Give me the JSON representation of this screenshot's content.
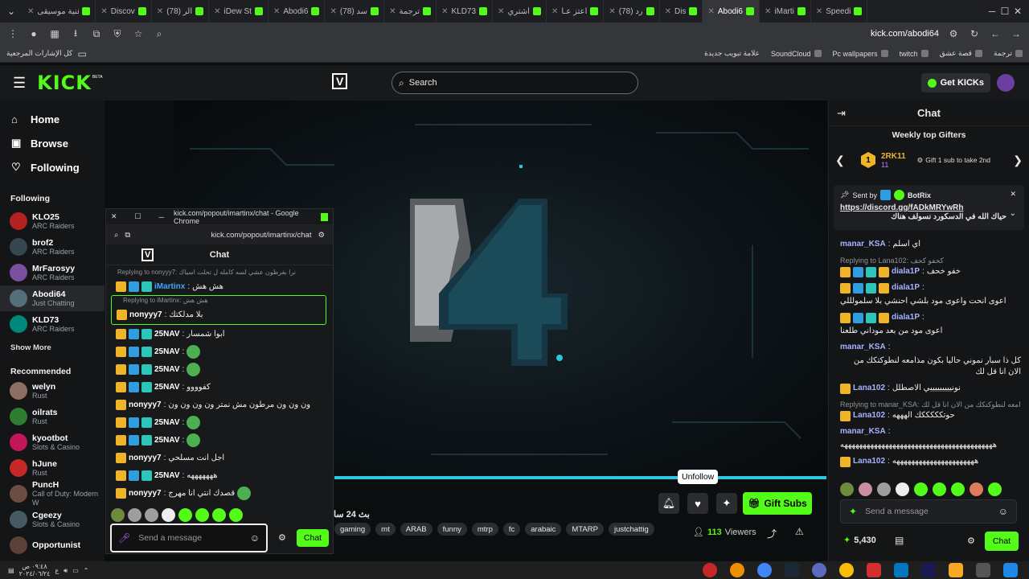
{
  "browser": {
    "tabs": [
      "اغنية موسيقى",
      "Discov",
      "(78) الر",
      "iDew St",
      "Abodi6",
      "(78) سد",
      "ترجمة",
      "KLD73",
      "اشتري",
      "اعتز عـا",
      "(78) رد",
      "Dis",
      "Abodi6",
      "iMarti",
      "Speedi"
    ],
    "url": "kick.com/abodi64",
    "bookmarks_left": "كل الإشارات المرجعية",
    "bookmarks": [
      "SoundCloud",
      "Pc wallpapers",
      "twitch",
      "قصة عشق",
      "ترجمة"
    ],
    "new_tab_bookmark": "علامة تبويب جديدة"
  },
  "header": {
    "logo": "KICK",
    "logo_beta": "BETA",
    "search_placeholder": "Search",
    "get_kicks": "Get KICKs"
  },
  "sidebar": {
    "nav": [
      {
        "label": "Home",
        "icon": "home-icon"
      },
      {
        "label": "Browse",
        "icon": "browse-icon"
      },
      {
        "label": "Following",
        "icon": "heart-icon"
      }
    ],
    "following_title": "Following",
    "following": [
      {
        "name": "KLO25",
        "sub": "ARC Raiders",
        "color": "#b22222"
      },
      {
        "name": "brof2",
        "sub": "ARC Raiders",
        "color": "#37474f"
      },
      {
        "name": "MrFarosyy",
        "sub": "ARC Raiders",
        "color": "#7b4fa0"
      },
      {
        "name": "Abodi64",
        "sub": "Just Chatting",
        "color": "#546e7a"
      },
      {
        "name": "KLD73",
        "sub": "ARC Raiders",
        "color": "#00897b"
      }
    ],
    "show_more": "Show More",
    "recommended_title": "Recommended",
    "recommended": [
      {
        "name": "welyn",
        "sub": "Rust",
        "color": "#8d6e63"
      },
      {
        "name": "oilrats",
        "sub": "Rust",
        "color": "#2e7d32"
      },
      {
        "name": "kyootbot",
        "sub": "Slots & Casino",
        "color": "#c2185b"
      },
      {
        "name": "hJune",
        "sub": "Rust",
        "color": "#c62828"
      },
      {
        "name": "PuncH",
        "sub": "Call of Duty: Modern W",
        "color": "#6d4c41"
      },
      {
        "name": "Cgeezy",
        "sub": "Slots & Casino",
        "color": "#455a64"
      },
      {
        "name": "Opportunist",
        "sub": "",
        "color": "#5d4037"
      }
    ]
  },
  "popup": {
    "title": "kick.com/popout/imartinx/chat - Google Chrome",
    "url": "kick.com/popout/imartinx/chat",
    "chat_title": "Chat",
    "messages": [
      {
        "reply": "Replying to nonyyy7: نرا بفرطون عشي لسه كامله ل تحلت اسياك",
        "user": "iMartinx",
        "color": "#3ea6ff",
        "text": "هش هش",
        "badges": 3
      },
      {
        "reply": "Replying to iMartinx: هش هش",
        "user": "nonyyy7",
        "color": "#ffffff",
        "text": "بلا مدلكتك",
        "badges": 1,
        "highlight": true
      },
      {
        "user": "25NAV",
        "color": "#ffffff",
        "text": "ابوا شمسار",
        "badges": 3
      },
      {
        "user": "25NAV",
        "color": "#ffffff",
        "text": "",
        "emote": true,
        "badges": 3
      },
      {
        "user": "25NAV",
        "color": "#ffffff",
        "text": "",
        "emote": true,
        "badges": 3
      },
      {
        "user": "25NAV",
        "color": "#ffffff",
        "text": "كفوووو",
        "badges": 3
      },
      {
        "user": "nonyyy7",
        "color": "#ffffff",
        "text": "ون ون ون مرطون مش نمتر ون ون ون ون",
        "badges": 1
      },
      {
        "user": "25NAV",
        "color": "#ffffff",
        "text": "",
        "emote": true,
        "badges": 3
      },
      {
        "user": "25NAV",
        "color": "#ffffff",
        "text": "",
        "emote": true,
        "badges": 3
      },
      {
        "user": "nonyyy7",
        "color": "#ffffff",
        "text": "اجل انت مسلحي",
        "badges": 1
      },
      {
        "user": "25NAV",
        "color": "#ffffff",
        "text": "هههههههه",
        "badges": 3
      },
      {
        "user": "nonyyy7",
        "color": "#ffffff",
        "text": "قصدك انتي انا مهرج",
        "emote": true,
        "badges": 1
      }
    ],
    "send_placeholder": "Send a message",
    "chat_button": "Chat"
  },
  "stream": {
    "unfollow_tooltip": "Unfollow",
    "gift_subs": "Gift Subs",
    "title_fragment": "بث 24 سا",
    "tags": [
      "gaming",
      "mt",
      "ARAB",
      "funny",
      "mtrp",
      "fc",
      "arabaic",
      "MTARP",
      "justchattig"
    ],
    "viewers": "113",
    "viewers_label": "Viewers"
  },
  "chat": {
    "title": "Chat",
    "gifters_title": "Weekly top Gifters",
    "gifter_rank": "1",
    "gifter_name": "2RK11",
    "gifter_count": "11",
    "gift_hint": "Gift 1 sub to take 2nd",
    "pinned_sender_prefix": "Sent by",
    "pinned_sender": "BotRix",
    "pinned_link": "https://discord.gg/fADkMRYwRh",
    "pinned_text": "حياك الله في الدسكورد نسولف هناك",
    "messages": [
      {
        "user": "manar_KSA",
        "color": "#a8b3ff",
        "text": "اي اسلم"
      },
      {
        "reply": "Replying to Lana102: كحفو كحف",
        "user": "diala1P",
        "color": "#a8b3ff",
        "text": "خفو خحف"
      },
      {
        "user": "diala1P",
        "color": "#a8b3ff",
        "text": "اعوى انحت واعوى مود بلشي احنشي بلا سلمولللي"
      },
      {
        "user": "diala1P",
        "color": "#a8b3ff",
        "text": "اعوى مود من بعد موداني طلعنا"
      },
      {
        "user": "manar_KSA",
        "color": "#a8b3ff",
        "text": "كل ذا سبار نموني حاليا بكون مذامعه لنطوكتكك من الان انا قل لك"
      },
      {
        "user": "Lana102",
        "color": "#a8b3ff",
        "text": "نونيييييييييي الاصطلل"
      },
      {
        "reply": "Replying to manar_KSA: مذامعه لنطوكتكك من الان انا قل لك",
        "user": "Lana102",
        "color": "#a8b3ff",
        "text": "حوتكككككك الهههه"
      },
      {
        "user": "manar_KSA",
        "color": "#a8b3ff",
        "text": "هههههههههههههههههههههههههههههههههههههههههه"
      },
      {
        "user": "Lana102",
        "color": "#a8b3ff",
        "text": "ههههههههههههههههههههههه"
      }
    ],
    "send_placeholder": "Send a message",
    "kicks_balance": "5,430",
    "chat_button": "Chat"
  },
  "taskbar": {
    "time": "٠٩:٤٨ ص",
    "date": "٢٠٢٤/٠٦/٢٤",
    "lang": "ع"
  }
}
